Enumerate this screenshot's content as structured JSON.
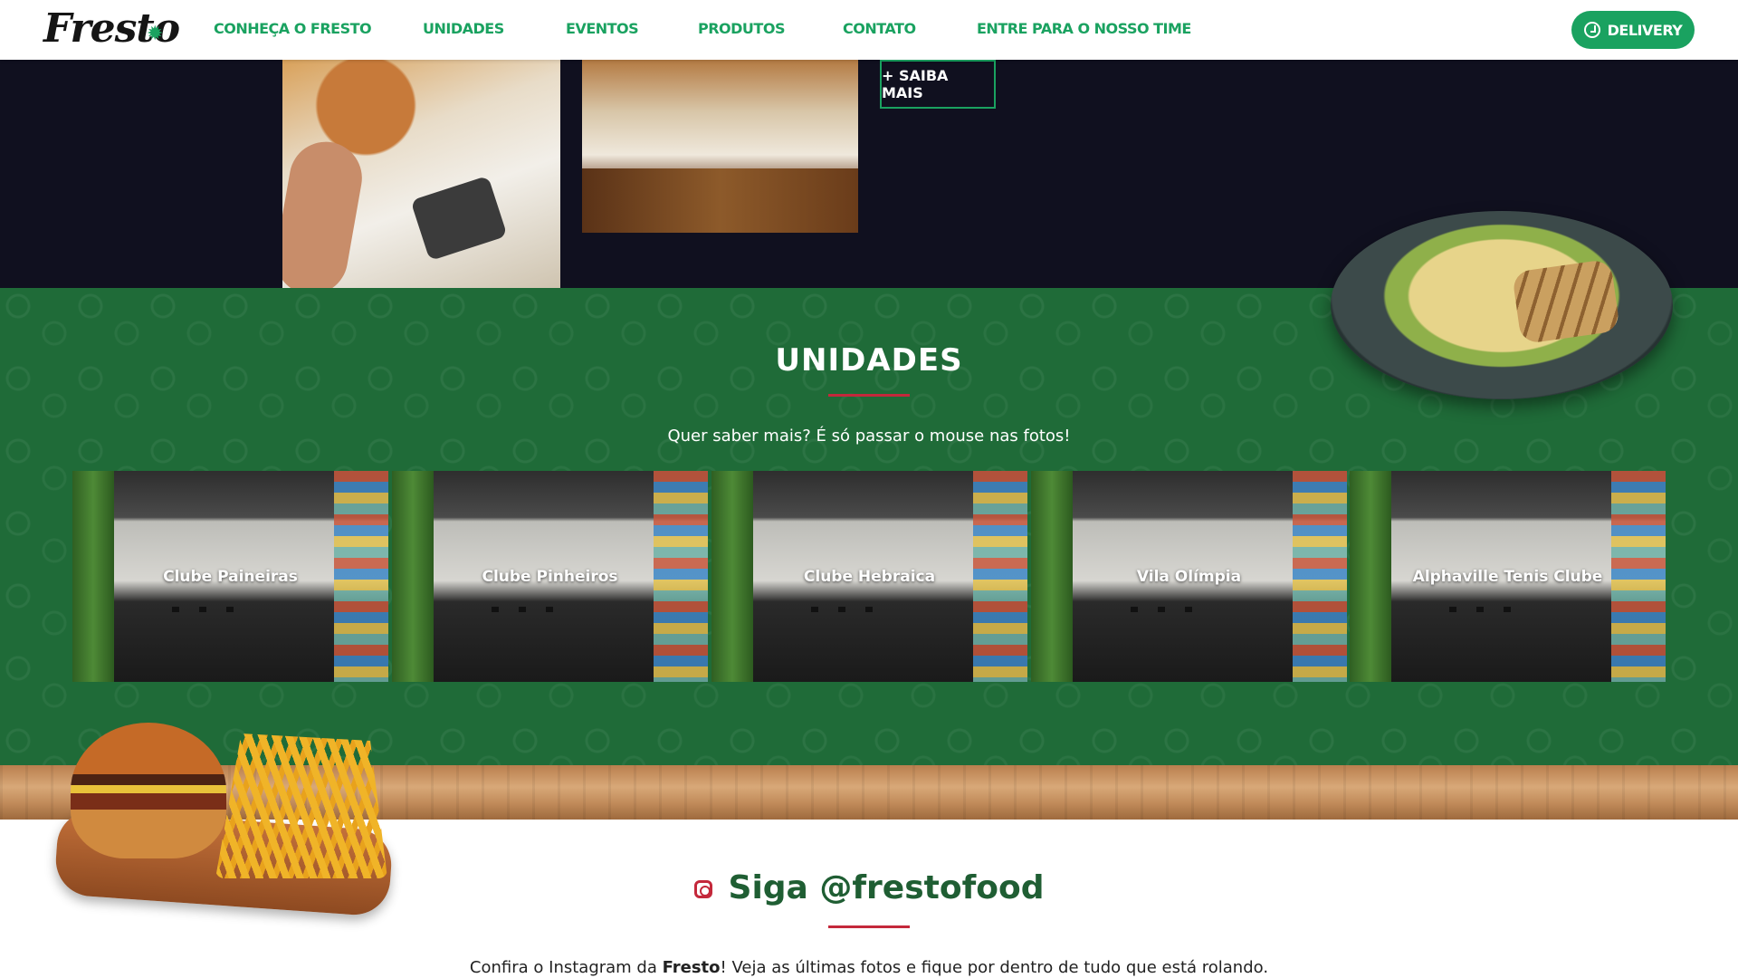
{
  "header": {
    "logo": "Fresto",
    "nav": [
      {
        "label": "CONHEÇA O FRESTO"
      },
      {
        "label": "UNIDADES"
      },
      {
        "label": "EVENTOS"
      },
      {
        "label": "PRODUTOS"
      },
      {
        "label": "CONTATO"
      },
      {
        "label": "ENTRE PARA O NOSSO TIME"
      }
    ],
    "delivery_label": "DELIVERY"
  },
  "hero": {
    "saiba_mais_label": "+ SAIBA MAIS"
  },
  "unidades": {
    "title": "UNIDADES",
    "subtitle": "Quer saber mais? É só passar o mouse nas fotos!",
    "items": [
      {
        "label": "Clube Paineiras"
      },
      {
        "label": "Clube Pinheiros"
      },
      {
        "label": "Clube Hebraica"
      },
      {
        "label": "Vila Olímpia"
      },
      {
        "label": "Alphaville Tenis Clube"
      }
    ]
  },
  "instagram": {
    "title": "Siga @frestofood",
    "subtitle_before": "Confira o Instagram da ",
    "subtitle_brand": "Fresto",
    "subtitle_after": "! Veja as últimas fotos e fique por dentro de tudo que está rolando."
  },
  "colors": {
    "brand_green": "#1aa260",
    "section_green": "#1f6b38",
    "dark_bg": "#10101f",
    "accent_red": "#c4283b"
  }
}
